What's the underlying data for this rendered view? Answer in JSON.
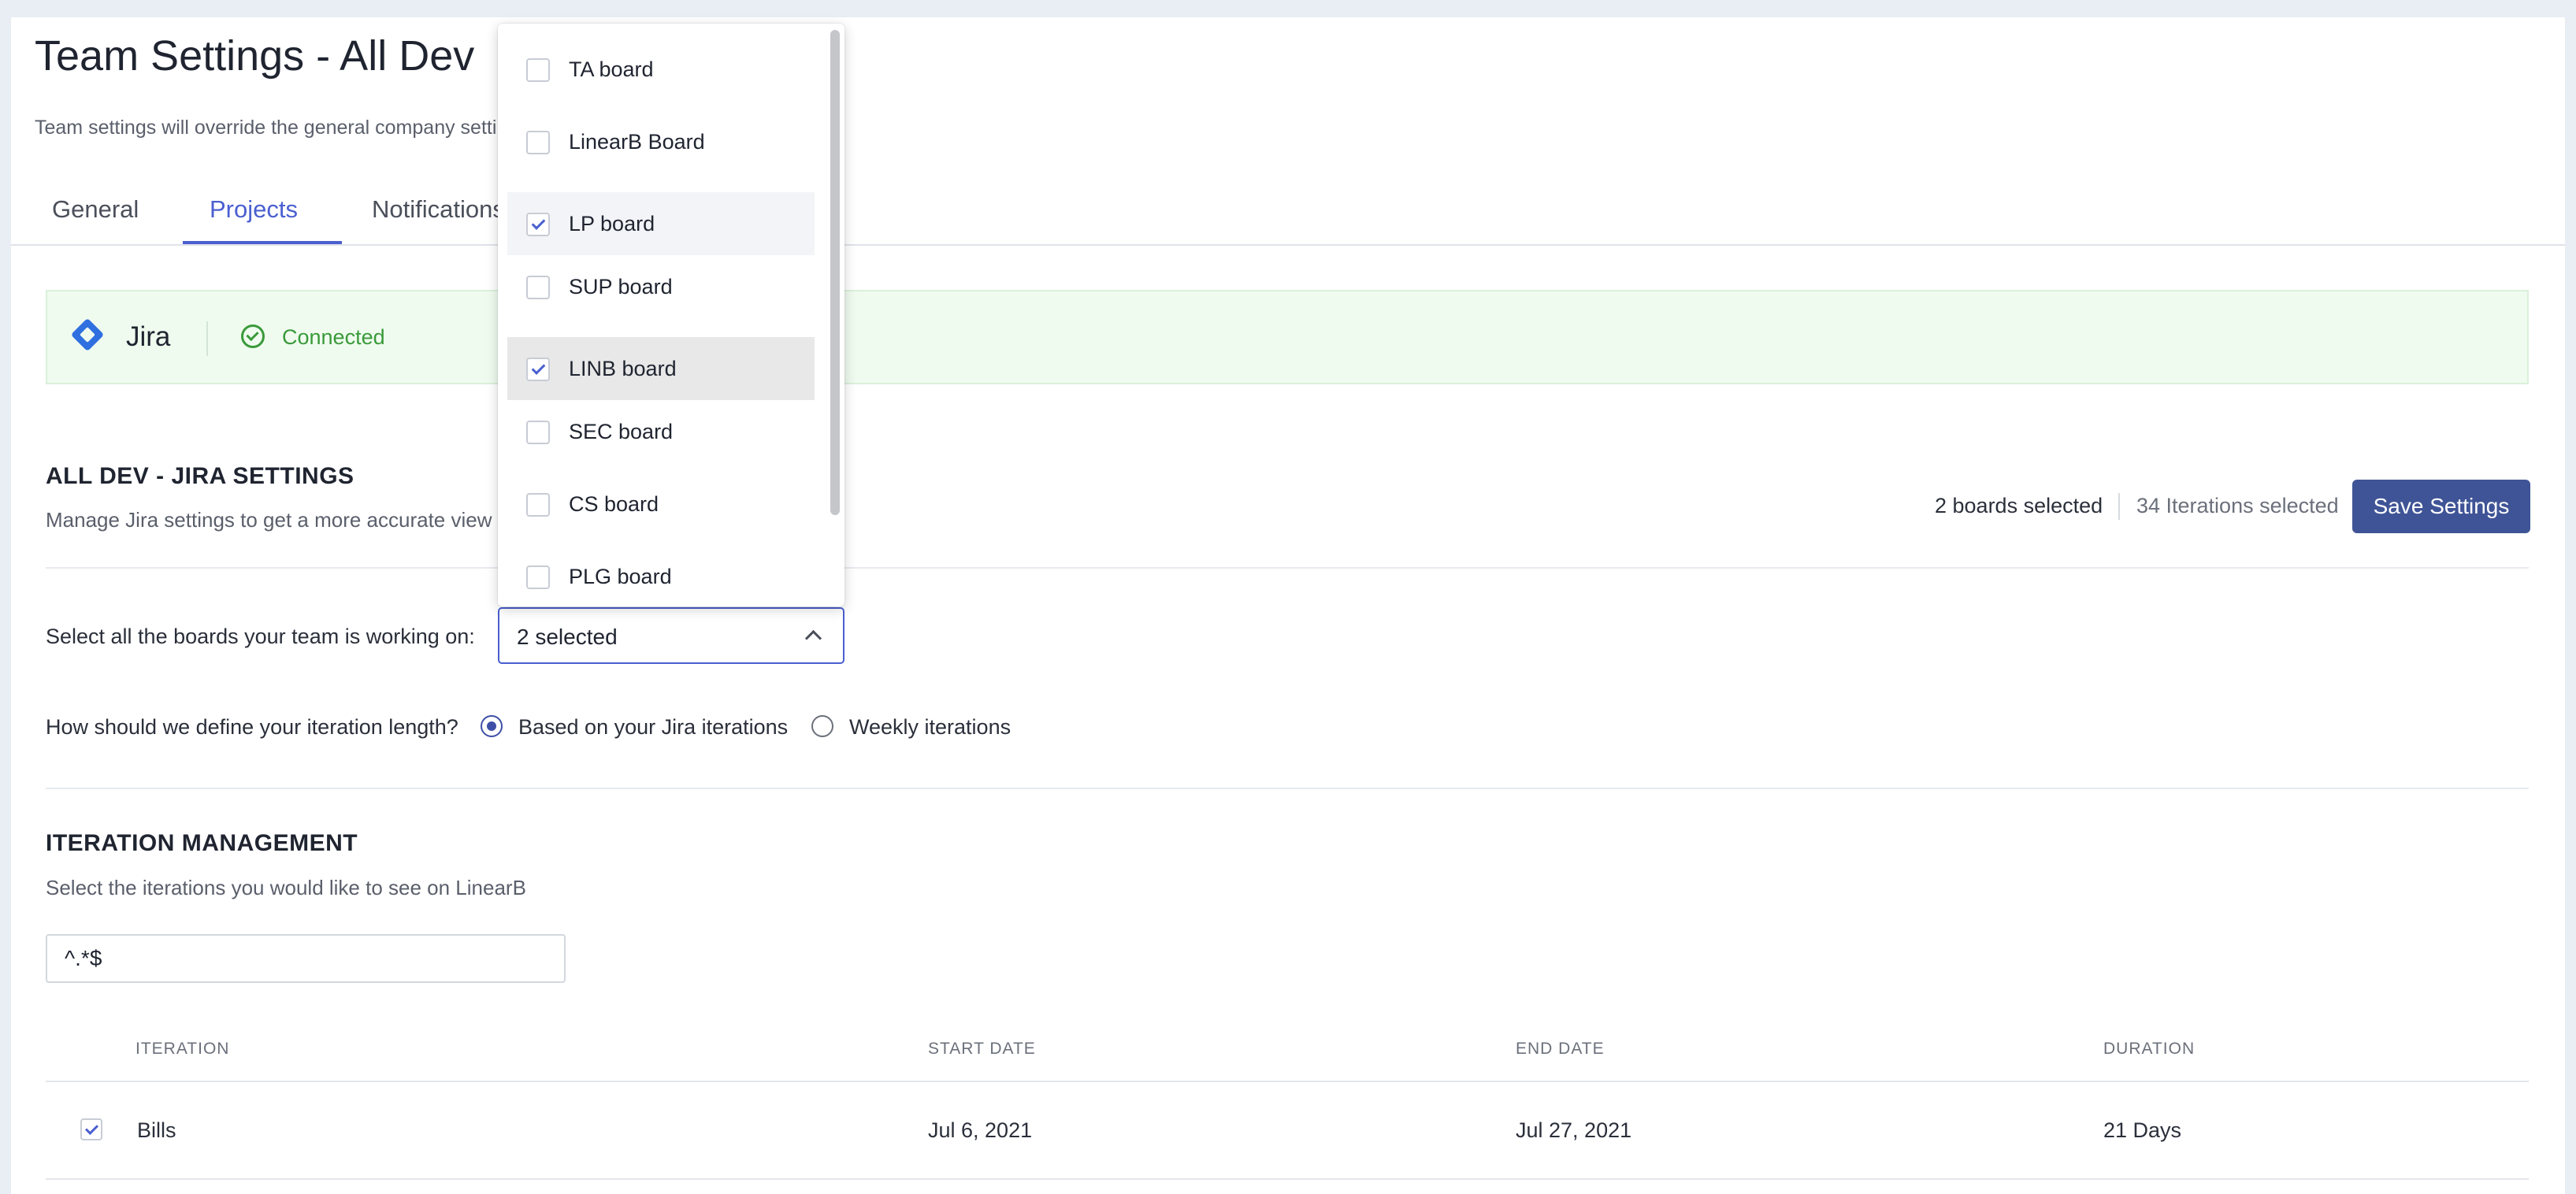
{
  "header": {
    "title": "Team Settings - All Dev",
    "subtitle": "Team settings will override the general company settings"
  },
  "tabs": [
    {
      "label": "General",
      "active": false
    },
    {
      "label": "Projects",
      "active": true
    },
    {
      "label": "Notifications",
      "active": false
    }
  ],
  "integration": {
    "name": "Jira",
    "status": "Connected",
    "status_color": "#3a9a3a"
  },
  "jira_settings": {
    "title": "ALL DEV - JIRA SETTINGS",
    "description": "Manage Jira settings to get a more accurate view",
    "boards_summary": "2 boards selected",
    "iterations_summary": "34 Iterations selected",
    "save_label": "Save Settings",
    "boards_label": "Select all the boards your team is working on:",
    "boards_value": "2 selected",
    "iteration_question": "How should we define your iteration length?",
    "iteration_options": [
      {
        "label": "Based on your Jira iterations",
        "selected": true
      },
      {
        "label": "Weekly iterations",
        "selected": false
      }
    ]
  },
  "boards_dropdown": {
    "items": [
      {
        "label": "TA board",
        "checked": false
      },
      {
        "label": "LinearB Board",
        "checked": false
      },
      {
        "label": "LP board",
        "checked": true
      },
      {
        "label": "SUP board",
        "checked": false
      },
      {
        "label": "LINB board",
        "checked": true
      },
      {
        "label": "SEC board",
        "checked": false
      },
      {
        "label": "CS board",
        "checked": false
      },
      {
        "label": "PLG board",
        "checked": false
      }
    ]
  },
  "iteration_management": {
    "title": "ITERATION MANAGEMENT",
    "description": "Select the iterations you would like to see on LinearB",
    "filter_value": "^.*$",
    "columns": [
      "ITERATION",
      "START DATE",
      "END DATE",
      "DURATION"
    ],
    "rows": [
      {
        "checked": true,
        "iteration": "Bills",
        "start": "Jul 6, 2021",
        "end": "Jul 27, 2021",
        "duration": "21 Days"
      }
    ]
  },
  "colors": {
    "accent": "#4a5fd0",
    "button": "#3f5496",
    "banner_bg": "#effbef",
    "jira_blue": "#2f6fe0"
  }
}
